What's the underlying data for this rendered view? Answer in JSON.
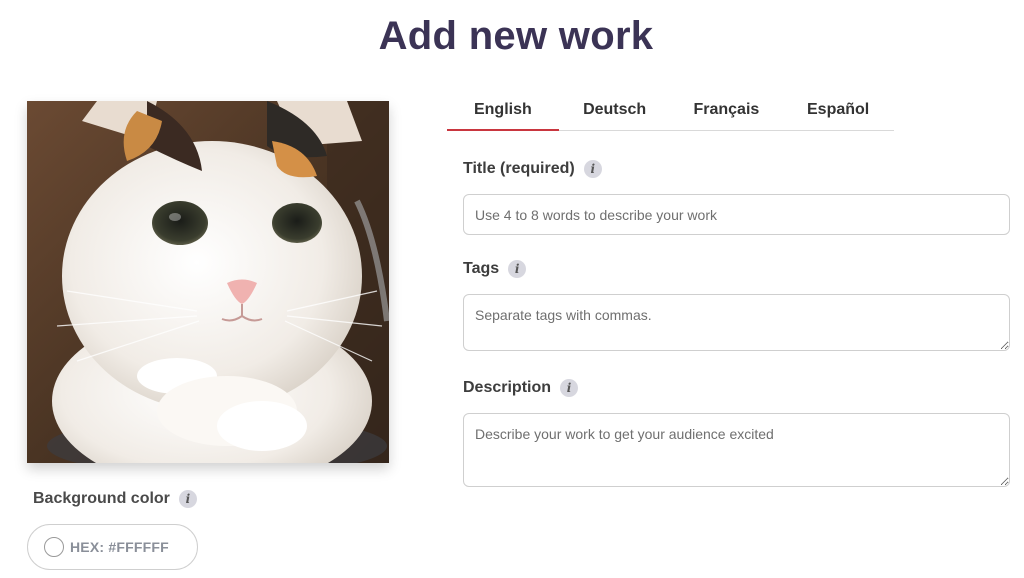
{
  "page": {
    "title": "Add new work"
  },
  "artwork": {
    "alt": ""
  },
  "background_color": {
    "label": "Background color",
    "hex_label": "HEX: #FFFFFF",
    "swatch_color": "#FFFFFF"
  },
  "tabs": [
    {
      "label": "English",
      "active": true
    },
    {
      "label": "Deutsch",
      "active": false
    },
    {
      "label": "Français",
      "active": false
    },
    {
      "label": "Español",
      "active": false
    }
  ],
  "form": {
    "title": {
      "label": "Title (required)",
      "value": "",
      "placeholder": "Use 4 to 8 words to describe your work"
    },
    "tags": {
      "label": "Tags",
      "value": "",
      "placeholder": "Separate tags with commas."
    },
    "description": {
      "label": "Description",
      "value": "",
      "placeholder": "Describe your work to get your audience excited"
    }
  },
  "colors": {
    "accent": "#c9363f",
    "title": "#3b3355"
  },
  "icons": {
    "info": "info-icon"
  },
  "info_glyph": "i"
}
